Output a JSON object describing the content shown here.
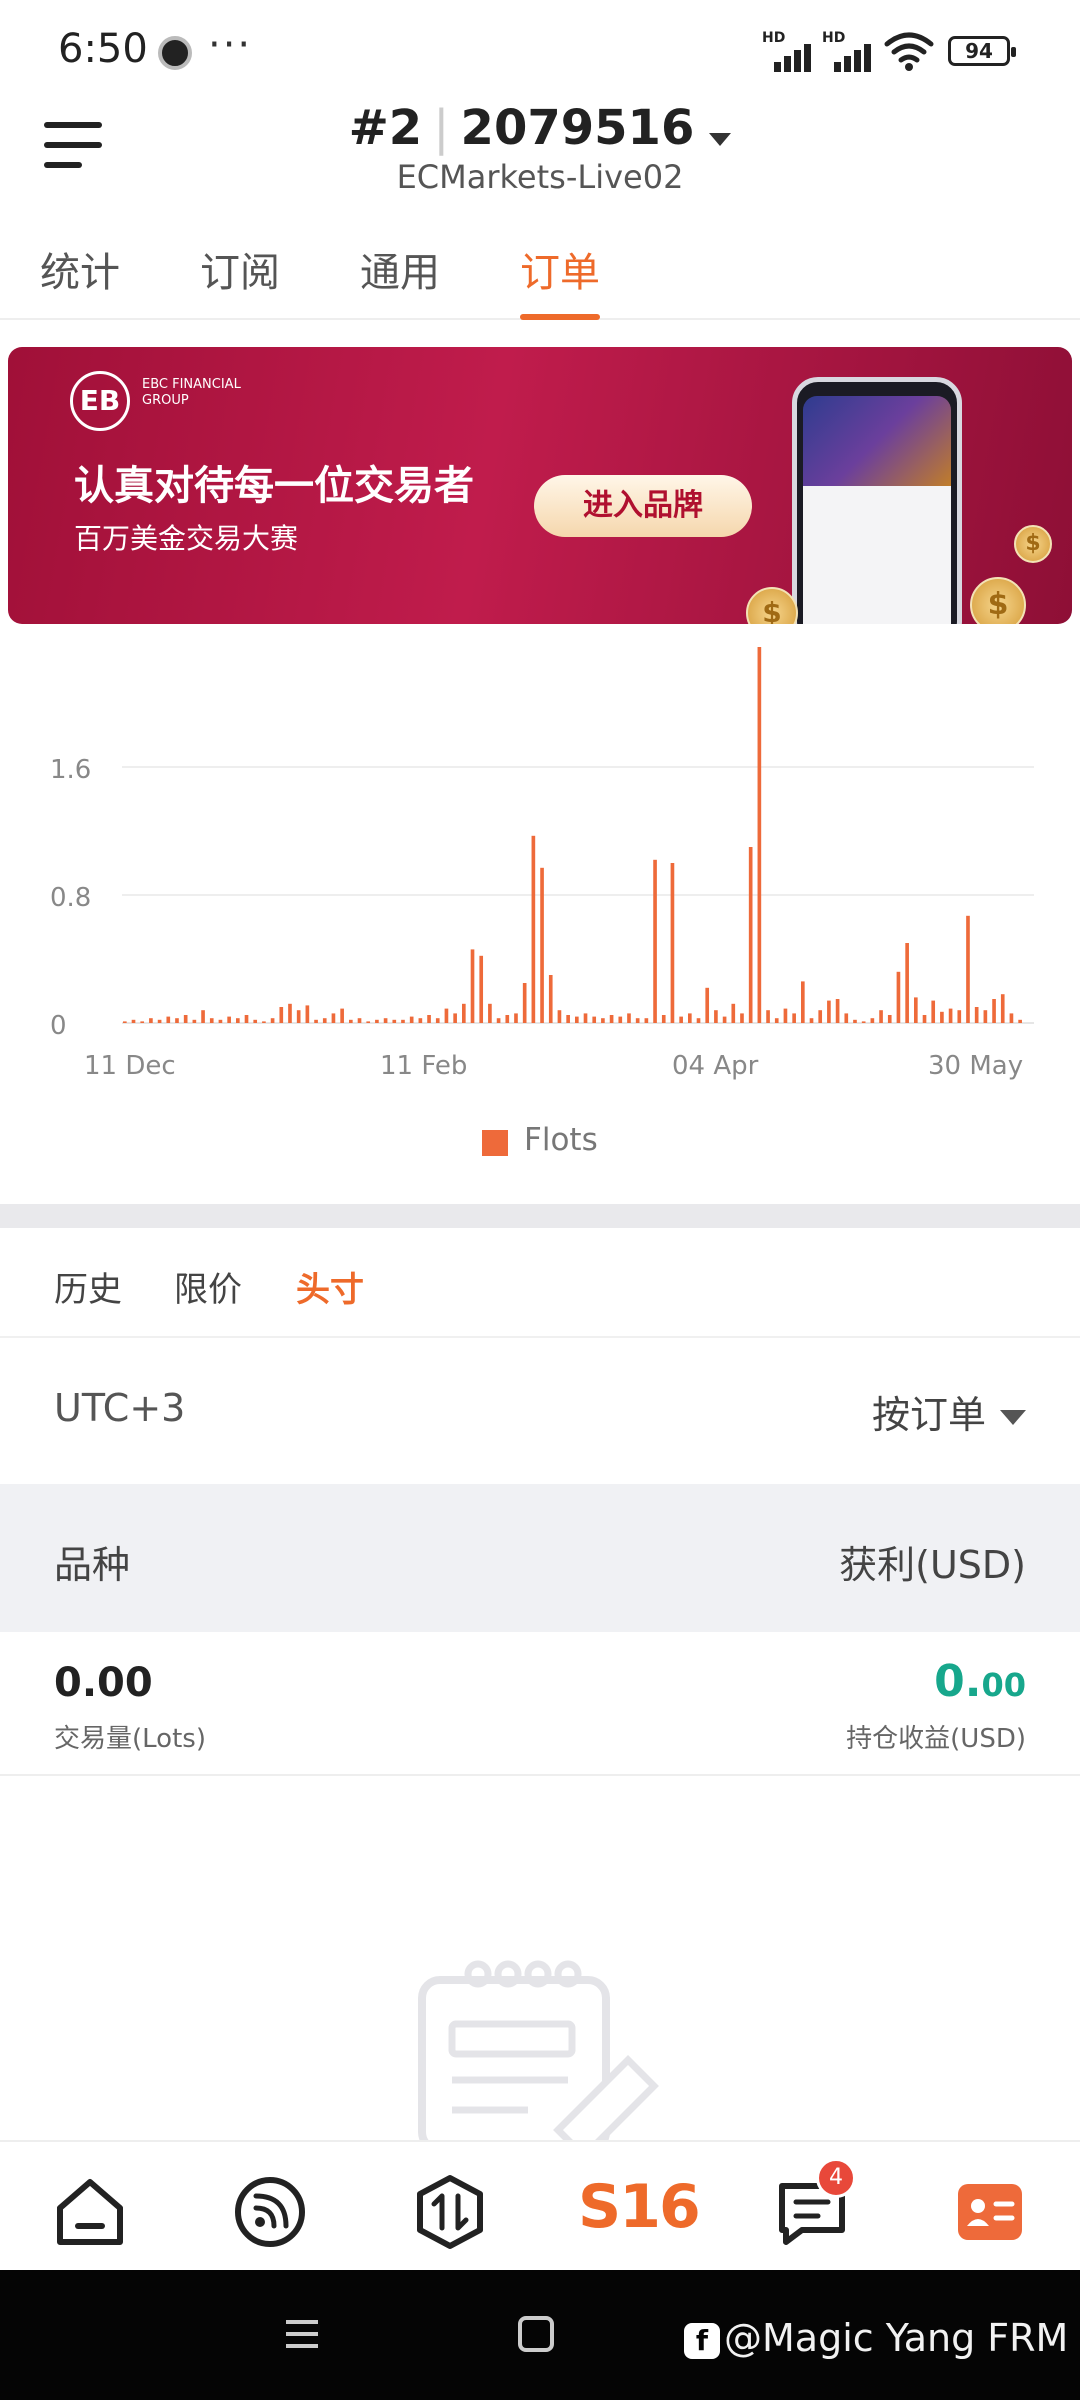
{
  "status_bar": {
    "time": "6:50",
    "overflow": "···",
    "network": "HD",
    "battery": "94"
  },
  "header": {
    "account_number": "#2",
    "account_id": "2079516",
    "server": "ECMarkets-Live02"
  },
  "tabs": [
    {
      "label": "统计",
      "active": false
    },
    {
      "label": "订阅",
      "active": false
    },
    {
      "label": "通用",
      "active": false
    },
    {
      "label": "订单",
      "active": true
    }
  ],
  "banner": {
    "logo_mark": "EB",
    "logo_text": "EBC FINANCIAL GROUP",
    "headline": "认真对待每一位交易者",
    "subline": "百万美金交易大赛",
    "cta": "进入品牌"
  },
  "chart_data": {
    "type": "bar",
    "x_tick_labels": [
      "11 Dec",
      "11 Feb",
      "04 Apr",
      "30 May"
    ],
    "y_tick_labels": [
      "0",
      "0.8",
      "1.6"
    ],
    "ylim": [
      0,
      2.4
    ],
    "grid": true,
    "legend": "bottom-center",
    "series": [
      {
        "name": "Flots",
        "color": "#ee6a3a",
        "values": [
          0.01,
          0.02,
          0.01,
          0.03,
          0.02,
          0.04,
          0.03,
          0.05,
          0.02,
          0.08,
          0.03,
          0.02,
          0.04,
          0.03,
          0.05,
          0.02,
          0.01,
          0.03,
          0.1,
          0.12,
          0.08,
          0.11,
          0.02,
          0.03,
          0.06,
          0.09,
          0.02,
          0.03,
          0.01,
          0.02,
          0.03,
          0.02,
          0.02,
          0.04,
          0.03,
          0.05,
          0.03,
          0.09,
          0.06,
          0.12,
          0.46,
          0.42,
          0.12,
          0.03,
          0.05,
          0.06,
          0.25,
          1.17,
          0.97,
          0.3,
          0.08,
          0.05,
          0.04,
          0.06,
          0.04,
          0.03,
          0.05,
          0.04,
          0.06,
          0.03,
          0.03,
          1.02,
          0.05,
          1.0,
          0.04,
          0.06,
          0.03,
          0.22,
          0.08,
          0.04,
          0.12,
          0.06,
          1.1,
          2.35,
          0.08,
          0.03,
          0.09,
          0.06,
          0.26,
          0.03,
          0.08,
          0.14,
          0.15,
          0.06,
          0.02,
          0.01,
          0.03,
          0.08,
          0.05,
          0.32,
          0.5,
          0.16,
          0.05,
          0.14,
          0.07,
          0.09,
          0.08,
          0.67,
          0.1,
          0.08,
          0.15,
          0.18,
          0.06,
          0.02
        ]
      }
    ]
  },
  "sub_tabs": [
    {
      "label": "历史",
      "active": false
    },
    {
      "label": "限价",
      "active": false
    },
    {
      "label": "头寸",
      "active": true
    }
  ],
  "filter": {
    "timezone": "UTC+3",
    "sort_label": "按订单"
  },
  "table_header": {
    "left": "品种",
    "right": "获利(USD)"
  },
  "summary": {
    "volume": "0.00",
    "volume_label": "交易量(Lots)",
    "profit_int": "0.",
    "profit_dec": "00",
    "profit_label": "持仓收益(USD)",
    "profit_color": "#17a78c"
  },
  "bottom_nav": {
    "s16_label": "S16",
    "messages_badge": "4"
  },
  "watermark": {
    "fb_glyph": "f",
    "text": "@Magic Yang FRM"
  },
  "colors": {
    "accent": "#ee6a2a",
    "banner": "#b0183f"
  }
}
